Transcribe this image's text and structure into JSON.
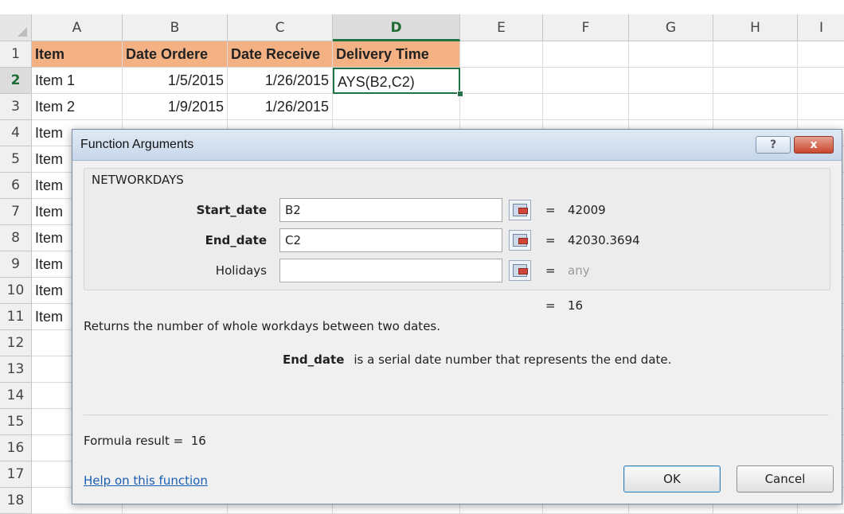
{
  "sheet": {
    "columns": [
      "A",
      "B",
      "C",
      "D",
      "E",
      "F",
      "G",
      "H",
      "I"
    ],
    "rows": [
      "1",
      "2",
      "3",
      "4",
      "5",
      "6",
      "7",
      "8",
      "9",
      "10",
      "11",
      "12",
      "13",
      "14",
      "15",
      "16",
      "17",
      "18"
    ],
    "active_column": "D",
    "active_row": "2",
    "header_fill": "#f4b183",
    "cells": {
      "A1": "Item",
      "B1": "Date  Ordere",
      "C1": "Date Receive",
      "D1": "Delivery Time",
      "A2": "Item 1",
      "B2": "1/5/2015",
      "C2": "1/26/2015",
      "D2": "AYS(B2,C2)",
      "A3": "Item 2",
      "B3": "1/9/2015",
      "C3": "1/26/2015",
      "A4": "Item",
      "A5": "Item",
      "A6": "Item",
      "A7": "Item",
      "A8": "Item",
      "A9": "Item",
      "A10": "Item",
      "A11": "Item"
    }
  },
  "dialog": {
    "title": "Function Arguments",
    "help_button": "?",
    "close_button": "x",
    "function_name": "NETWORKDAYS",
    "args": [
      {
        "label": "Start_date",
        "value": "B2",
        "result": "42009",
        "bold": true
      },
      {
        "label": "End_date",
        "value": "C2",
        "result": "42030.3694",
        "bold": true
      },
      {
        "label": "Holidays",
        "value": "",
        "result": "any",
        "bold": false
      }
    ],
    "equals": "=",
    "overall_result": "16",
    "description": "Returns the number of whole workdays between two dates.",
    "arg_desc_name": "End_date",
    "arg_desc_text": "is a serial date number that represents the end date.",
    "formula_result_label": "Formula result =",
    "formula_result_value": "16",
    "help_link": "Help on this function",
    "ok": "OK",
    "cancel": "Cancel"
  }
}
